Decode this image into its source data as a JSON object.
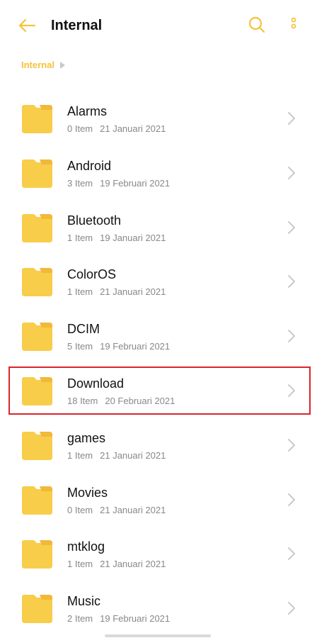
{
  "header": {
    "title": "Internal",
    "back_icon": "arrow-left-icon",
    "search_icon": "search-icon",
    "more_icon": "more-vertical-icon",
    "accent_color": "#f5c23a"
  },
  "breadcrumb": {
    "items": [
      "Internal"
    ]
  },
  "folders": [
    {
      "name": "Alarms",
      "count": "0 Item",
      "date": "21 Januari 2021"
    },
    {
      "name": "Android",
      "count": "3 Item",
      "date": "19 Februari 2021"
    },
    {
      "name": "Bluetooth",
      "count": "1 Item",
      "date": "19 Januari 2021"
    },
    {
      "name": "ColorOS",
      "count": "1 Item",
      "date": "21 Januari 2021"
    },
    {
      "name": "DCIM",
      "count": "5 Item",
      "date": "19 Februari 2021"
    },
    {
      "name": "Download",
      "count": "18 Item",
      "date": "20 Februari 2021",
      "highlighted": true
    },
    {
      "name": "games",
      "count": "1 Item",
      "date": "21 Januari 2021"
    },
    {
      "name": "Movies",
      "count": "0 Item",
      "date": "21 Januari 2021"
    },
    {
      "name": "mtklog",
      "count": "1 Item",
      "date": "21 Januari 2021"
    },
    {
      "name": "Music",
      "count": "2 Item",
      "date": "19 Februari 2021"
    }
  ],
  "colors": {
    "folder": "#f8cd4a",
    "folder_tab": "#f2b83a",
    "highlight_border": "#d9252b"
  }
}
